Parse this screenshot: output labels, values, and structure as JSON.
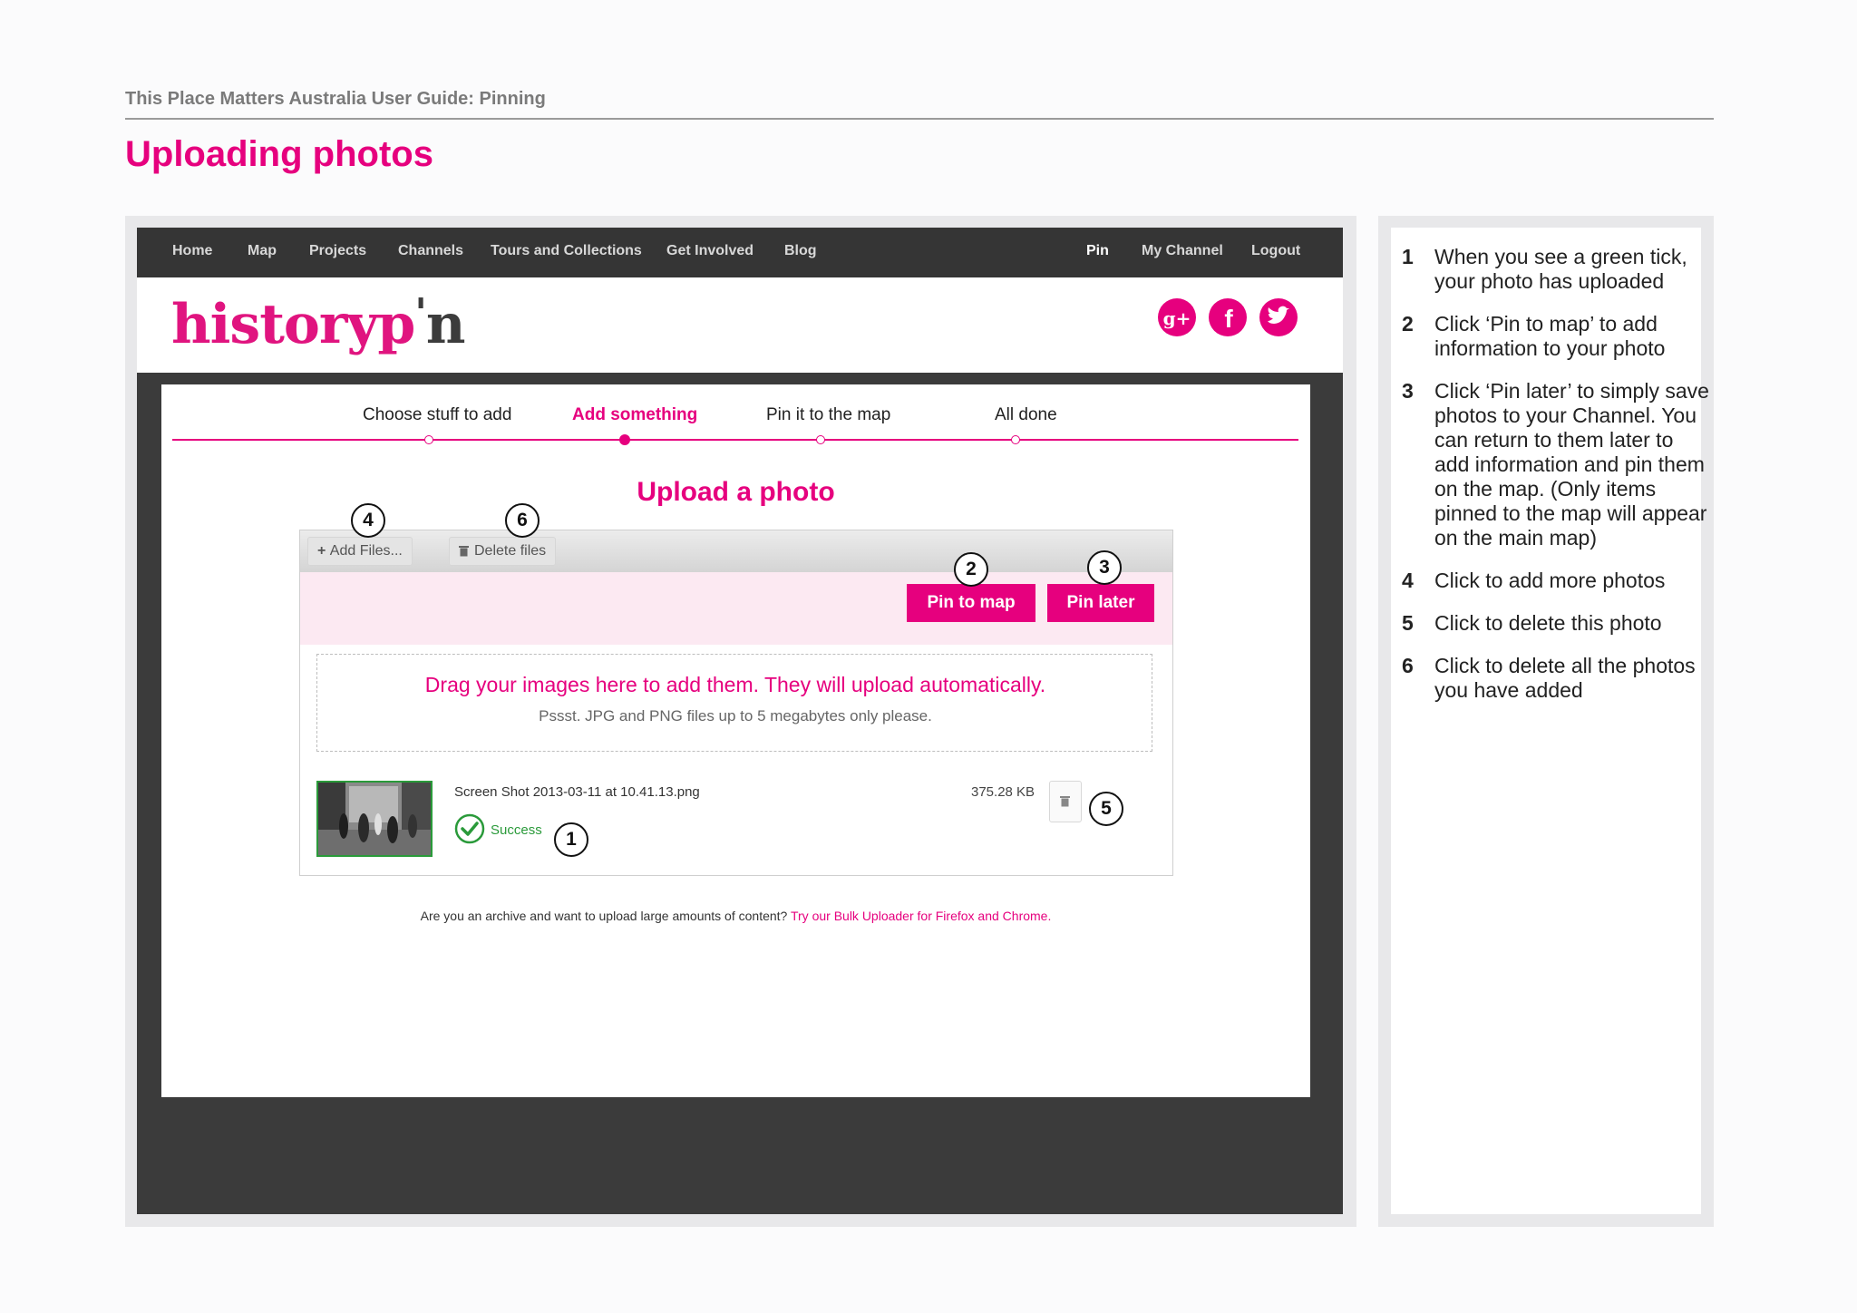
{
  "doc": {
    "header": "This Place Matters Australia User Guide: Pinning",
    "title": "Uploading photos"
  },
  "app": {
    "nav_left": [
      "Home",
      "Map",
      "Projects",
      "Channels",
      "Tours and Collections",
      "Get Involved",
      "Blog"
    ],
    "nav_right": [
      "Pin",
      "My Channel",
      "Logout"
    ],
    "logo_parts": {
      "main": "historyp",
      "apos": "'",
      "end": "n"
    },
    "social_icons": [
      "google-plus-icon",
      "facebook-icon",
      "twitter-icon"
    ],
    "steps": [
      "Choose stuff to add",
      "Add something",
      "Pin it to the map",
      "All done"
    ],
    "active_step": "Add something",
    "upload_title": "Upload a photo",
    "add_files": "Add Files...",
    "delete_files": "Delete files",
    "pin_to_map": "Pin to map",
    "pin_later": "Pin later",
    "drop_main": "Drag your images here to add them. They will upload automatically.",
    "drop_sub": "Pssst. JPG and PNG files up to 5 megabytes only please.",
    "file": {
      "name": "Screen Shot 2013-03-11 at 10.41.13.png",
      "size": "375.28 KB",
      "status": "Success"
    },
    "archive_text": "Are you an archive and want to upload large amounts of content?",
    "archive_link": "Try our Bulk Uploader for Firefox and Chrome."
  },
  "callouts": [
    "1",
    "2",
    "3",
    "4",
    "5",
    "6"
  ],
  "instructions": [
    {
      "num": "1",
      "text": "When you see a green tick, your photo has uploaded"
    },
    {
      "num": "2",
      "text": "Click ‘Pin to map’ to add information to your photo"
    },
    {
      "num": "3",
      "text": "Click ‘Pin later’ to simply save photos to your Channel. You can return to them later to add information and pin them on the map. (Only items pinned to the map will appear on the main map)"
    },
    {
      "num": "4",
      "text": "Click to add more photos"
    },
    {
      "num": "5",
      "text": "Click to delete this photo"
    },
    {
      "num": "6",
      "text": "Click to delete all the photos you have added"
    }
  ],
  "colors": {
    "accent": "#e6007e",
    "success": "#2a9a3a",
    "navbar": "#353535"
  }
}
